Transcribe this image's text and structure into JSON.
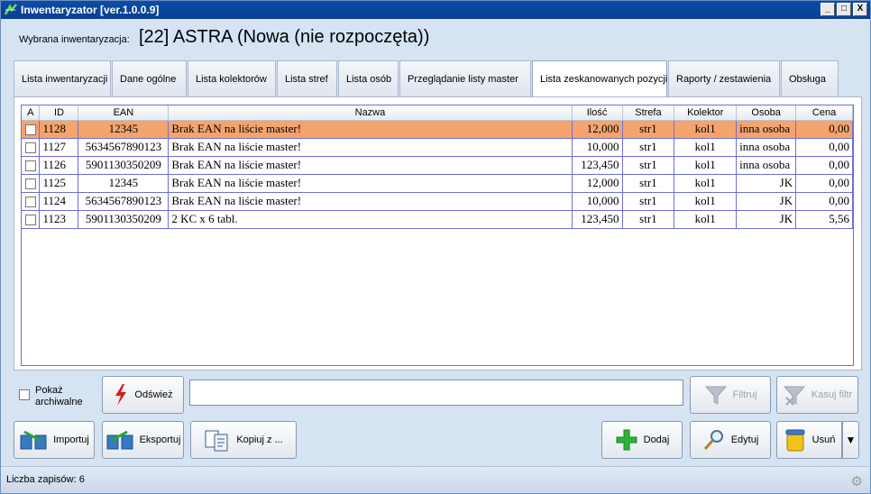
{
  "window": {
    "title": "Inwentaryzator [ver.1.0.0.9]",
    "min": "_",
    "max": "□",
    "close": "X"
  },
  "selection": {
    "label": "Wybrana inwentaryzacja:",
    "value": "[22] ASTRA (Nowa (nie rozpoczęta))"
  },
  "tabs": [
    {
      "label": "Lista inwentaryzacji"
    },
    {
      "label": "Dane ogólne"
    },
    {
      "label": "Lista kolektorów"
    },
    {
      "label": "Lista stref"
    },
    {
      "label": "Lista osób"
    },
    {
      "label": "Przeglądanie listy master"
    },
    {
      "label": "Lista zeskanowanych pozycji"
    },
    {
      "label": "Raporty / zestawienia"
    },
    {
      "label": "Obsługa"
    }
  ],
  "grid": {
    "columns": [
      "A",
      "ID",
      "EAN",
      "Nazwa",
      "Ilość",
      "Strefa",
      "Kolektor",
      "Osoba",
      "Cena"
    ],
    "rows": [
      {
        "id": "1128",
        "ean": "12345",
        "nazwa": "Brak EAN na liście master!",
        "ilosc": "12,000",
        "strefa": "str1",
        "kolektor": "kol1",
        "osoba": "inna osoba",
        "cena": "0,00"
      },
      {
        "id": "1127",
        "ean": "5634567890123",
        "nazwa": "Brak EAN na liście master!",
        "ilosc": "10,000",
        "strefa": "str1",
        "kolektor": "kol1",
        "osoba": "inna osoba",
        "cena": "0,00"
      },
      {
        "id": "1126",
        "ean": "5901130350209",
        "nazwa": "Brak EAN na liście master!",
        "ilosc": "123,450",
        "strefa": "str1",
        "kolektor": "kol1",
        "osoba": "inna osoba",
        "cena": "0,00"
      },
      {
        "id": "1125",
        "ean": "12345",
        "nazwa": "Brak EAN na liście master!",
        "ilosc": "12,000",
        "strefa": "str1",
        "kolektor": "kol1",
        "osoba": "JK",
        "cena": "0,00"
      },
      {
        "id": "1124",
        "ean": "5634567890123",
        "nazwa": "Brak EAN na liście master!",
        "ilosc": "10,000",
        "strefa": "str1",
        "kolektor": "kol1",
        "osoba": "JK",
        "cena": "0,00"
      },
      {
        "id": "1123",
        "ean": "5901130350209",
        "nazwa": "2 KC x 6 tabl.",
        "ilosc": "123,450",
        "strefa": "str1",
        "kolektor": "kol1",
        "osoba": "JK",
        "cena": "5,56"
      }
    ]
  },
  "controls": {
    "archive_label_1": "Pokaż",
    "archive_label_2": "archiwalne",
    "refresh": "Odśwież",
    "filter": "Filtruj",
    "clear_filter": "Kasuj filtr",
    "import": "Importuj",
    "export": "Eksportuj",
    "copy": "Kopiuj z ...",
    "add": "Dodaj",
    "edit": "Edytuj",
    "delete": "Usuń"
  },
  "status": {
    "text": "Liczba zapisów: 6"
  },
  "colors": {
    "selected_row": "#f5a46e",
    "grid_border": "#6e6ed6",
    "title_bar": "#0b4da8"
  }
}
